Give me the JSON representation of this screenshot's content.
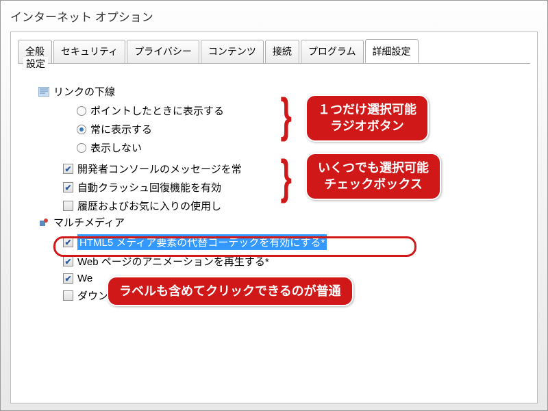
{
  "window": {
    "title": "インターネット オプション"
  },
  "tabs": [
    {
      "label": "全般"
    },
    {
      "label": "セキュリティ"
    },
    {
      "label": "プライバシー"
    },
    {
      "label": "コンテンツ"
    },
    {
      "label": "接続"
    },
    {
      "label": "プログラム"
    },
    {
      "label": "詳細設定",
      "active": true
    }
  ],
  "panel": {
    "legend": "設定"
  },
  "sections": {
    "links": {
      "title": "リンクの下線",
      "radios": [
        {
          "label": "ポイントしたときに表示する",
          "checked": false
        },
        {
          "label": "常に表示する",
          "checked": true
        },
        {
          "label": "表示しない",
          "checked": false
        }
      ]
    },
    "checkboxes_a": [
      {
        "label": "開発者コンソールのメッセージを常",
        "checked": true
      },
      {
        "label": "自動クラッシュ回復機能を有効",
        "checked": true
      },
      {
        "label": "履歴およびお気に入りの使用し",
        "checked": false
      }
    ],
    "multimedia": {
      "title": "マルチメディア",
      "items": [
        {
          "label": "HTML5 メディア要素の代替コーデックを有効にする*",
          "checked": true,
          "highlighted": true
        },
        {
          "label": "Web ページのアニメーションを再生する*",
          "checked": true
        },
        {
          "label": "We",
          "checked": true
        },
        {
          "label": "ダウンロードする画像のプレースホルダーを表示する",
          "checked": false
        }
      ]
    }
  },
  "callouts": {
    "radio": "１つだけ選択可能\nラジオボタン",
    "checkbox": "いくつでも選択可能\nチェックボックス",
    "label": "ラベルも含めてクリックできるのが普通"
  }
}
